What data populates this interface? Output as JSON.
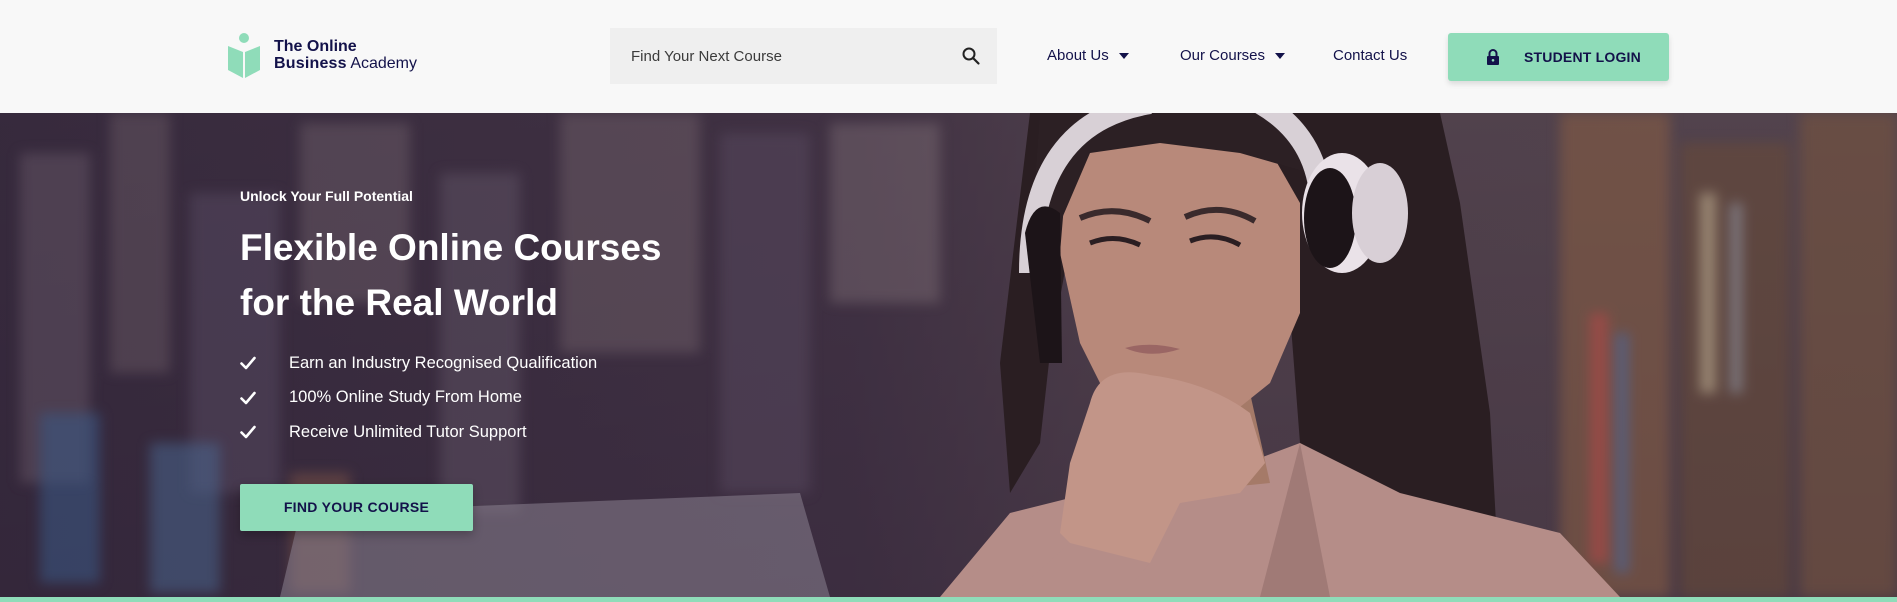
{
  "header": {
    "logo": {
      "line1_the": "The",
      "line1_online": "Online",
      "line2_business": "Business",
      "line2_academy": "Academy",
      "icon": "open-book-person-icon"
    },
    "search": {
      "placeholder": "Find Your Next Course",
      "icon": "search-icon"
    },
    "nav": {
      "about": "About Us",
      "courses": "Our Courses",
      "contact": "Contact Us"
    },
    "login": {
      "label": "STUDENT LOGIN",
      "icon": "lock-icon"
    }
  },
  "hero": {
    "eyebrow": "Unlock Your Full Potential",
    "headline_line1": "Flexible Online Courses",
    "headline_line2": "for the Real World",
    "benefits": [
      "Earn an Industry Recognised Qualification",
      "100% Online Study From Home",
      "Receive Unlimited Tutor Support"
    ],
    "cta_label": "FIND YOUR COURSE"
  },
  "colors": {
    "accent": "#8fdcb9",
    "brand_navy": "#13124a",
    "header_bg": "#f8f8f8",
    "search_bg": "#efefef"
  }
}
